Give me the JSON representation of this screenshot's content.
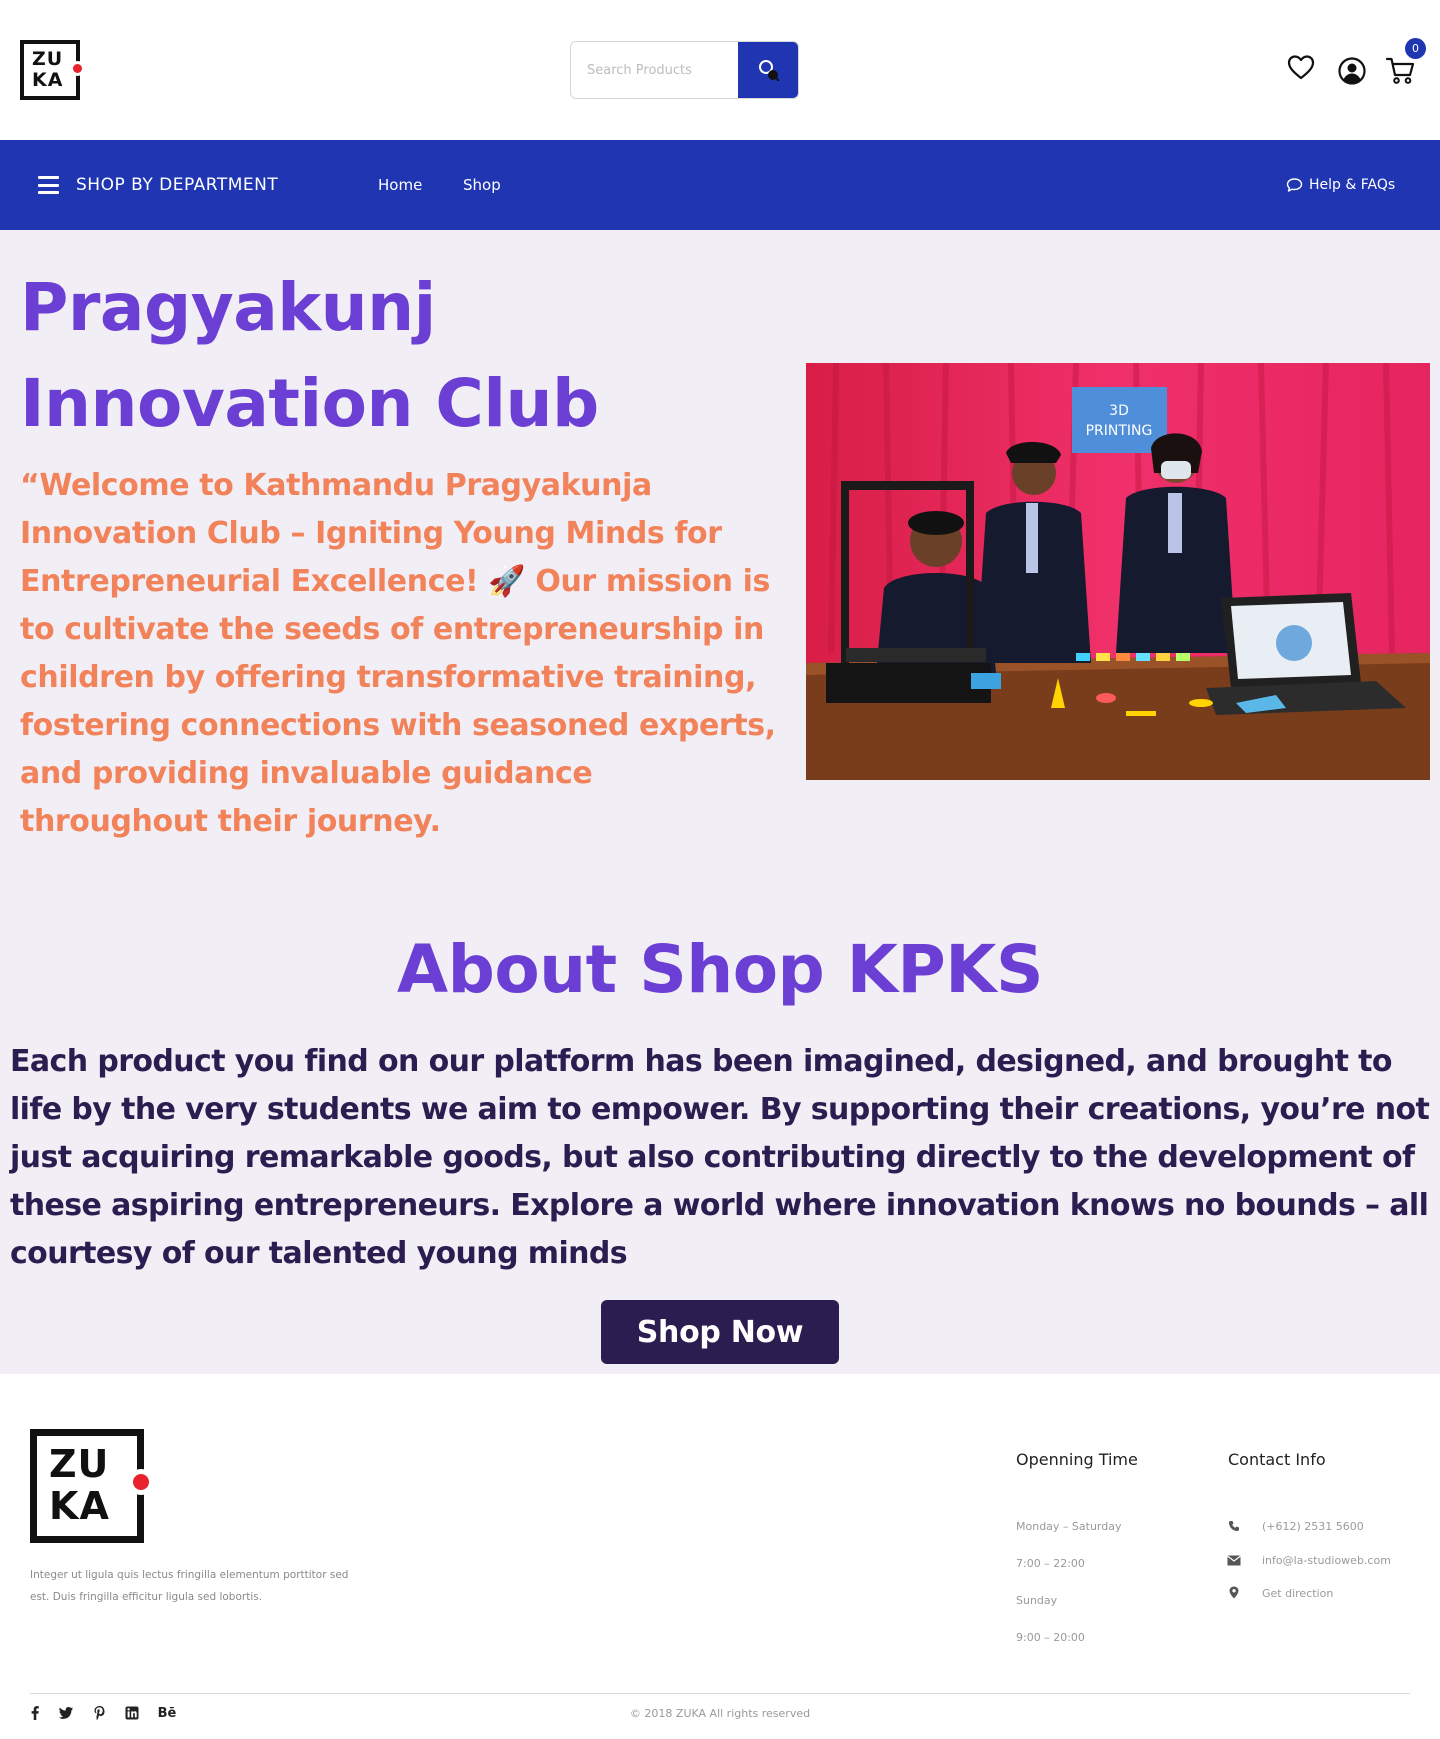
{
  "header": {
    "logo": {
      "line1": "ZU",
      "line2": "KA"
    },
    "search": {
      "placeholder": "Search Products",
      "value": ""
    },
    "icons": [
      "search-icon",
      "heart-icon",
      "user-icon",
      "cart-icon"
    ],
    "cart_count": "0"
  },
  "nav": {
    "department_label": "SHOP BY DEPARTMENT",
    "links": [
      "Home",
      "Shop"
    ],
    "help_label": "Help & FAQs"
  },
  "hero": {
    "title": "Pragyakunj Innovation Club",
    "text": "“Welcome to Kathmandu Pragyakunja Innovation Club – Igniting Young Minds for Entrepreneurial Excellence! 🚀 Our mission is to cultivate the seeds of entrepreneurship in children by offering transformative training, fostering connections with seasoned experts, and providing invaluable guidance throughout their journey.",
    "image_sign": {
      "line1": "3D",
      "line2": "PRINTING"
    }
  },
  "about": {
    "title": "About Shop KPKS",
    "text": "Each product you find on our platform has been imagined, designed, and brought to life by the very students we aim to empower. By supporting their creations, you’re not just acquiring remarkable goods, but also contributing directly to the development of these aspiring entrepreneurs. Explore a world where innovation knows no bounds – all courtesy of our talented young minds",
    "button_label": "Shop Now"
  },
  "footer": {
    "logo": {
      "line1": "ZU",
      "line2": "KA"
    },
    "description": "Integer ut ligula quis lectus fringilla elementum porttitor sed est. Duis fringilla efficitur ligula sed lobortis.",
    "opening": {
      "title": "Openning Time",
      "items": [
        "Monday – Saturday",
        "7:00 – 22:00",
        "Sunday",
        "9:00 – 20:00"
      ]
    },
    "contact": {
      "title": "Contact Info",
      "phone": "(+612) 2531 5600",
      "email": "info@la-studioweb.com",
      "direction": "Get direction"
    },
    "social_icons": [
      "facebook-icon",
      "twitter-icon",
      "pinterest-icon",
      "linkedin-icon",
      "behance-icon"
    ],
    "behance_label": "Bē",
    "copyright": "© 2018 ZUKA All rights reserved"
  },
  "colors": {
    "brand_blue": "#1f35b2",
    "purple": "#6b3fd4",
    "orange": "#f2825a",
    "dark": "#2b1d4f",
    "section_bg": "#f1eef6"
  }
}
